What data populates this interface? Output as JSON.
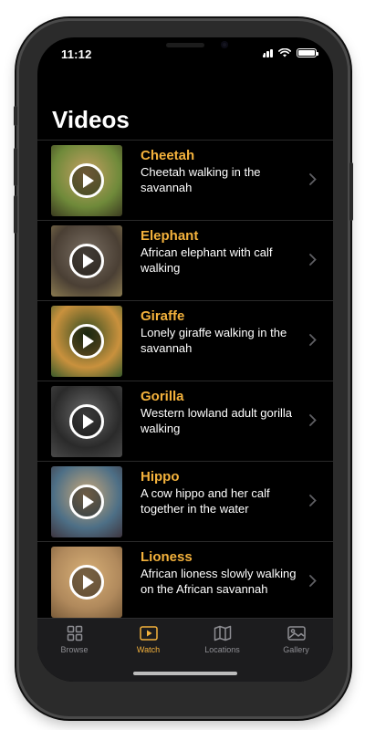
{
  "status": {
    "time": "11:12"
  },
  "title": "Videos",
  "items": [
    {
      "name": "Cheetah",
      "description": "Cheetah walking in the savannah",
      "thumb": [
        "#c7a063",
        "#6f8a3a",
        "#3b3b20"
      ]
    },
    {
      "name": "Elephant",
      "description": "African elephant with calf walking",
      "thumb": [
        "#7a6f63",
        "#4a3f34",
        "#8a7a50"
      ]
    },
    {
      "name": "Giraffe",
      "description": "Lonely giraffe walking in the savannah",
      "thumb": [
        "#2f4a1f",
        "#c9913d",
        "#3a5a2a"
      ]
    },
    {
      "name": "Gorilla",
      "description": "Western lowland adult gorilla walking",
      "thumb": [
        "#6a6a6a",
        "#2a2a2a",
        "#4a4a4a"
      ]
    },
    {
      "name": "Hippo",
      "description": "A cow hippo and her calf together in the water",
      "thumb": [
        "#c9a87a",
        "#4d6f86",
        "#3e3640"
      ]
    },
    {
      "name": "Lioness",
      "description": "African lioness slowly walking on the African savannah",
      "thumb": [
        "#d9b178",
        "#b0895c",
        "#7a5c3a"
      ]
    }
  ],
  "tabs": [
    {
      "label": "Browse",
      "icon": "grid-icon"
    },
    {
      "label": "Watch",
      "icon": "play-rectangle-icon",
      "active": true
    },
    {
      "label": "Locations",
      "icon": "map-icon"
    },
    {
      "label": "Gallery",
      "icon": "photo-icon"
    }
  ],
  "colors": {
    "accent": "#f4b23c",
    "background": "#000000",
    "tabbar": "#1c1c1e"
  }
}
